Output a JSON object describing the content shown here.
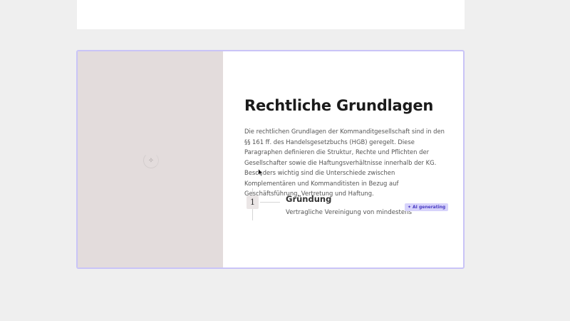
{
  "slide": {
    "title": "Rechtliche Grundlagen",
    "body": "Die rechtlichen Grundlagen der Kommanditgesellschaft sind in den §§ 161 ff. des Handelsgesetzbuchs (HGB) geregelt. Diese Paragraphen definieren die Struktur, Rechte und Pflichten der Gesellschafter sowie die Haftungsverhältnisse innerhalb der KG. Besonders wichtig sind die Unterschiede zwischen Komplementären und Kommanditisten in Bezug auf Geschäftsführung, Vertretung und Haftung.",
    "steps": [
      {
        "number": "1",
        "title": "Gründung",
        "description": "Vertragliche Vereinigung von mindestens"
      }
    ],
    "ai_badge": {
      "icon": "sparkle-icon",
      "label": "AI generating"
    },
    "image_placeholder_icon": "sparkle-icon"
  },
  "colors": {
    "canvas": "#efefef",
    "slide_border": "#c9c4f7",
    "image_panel": "#e3dcdc",
    "badge_bg": "#d7d3fb",
    "badge_text": "#4a3cc4"
  }
}
